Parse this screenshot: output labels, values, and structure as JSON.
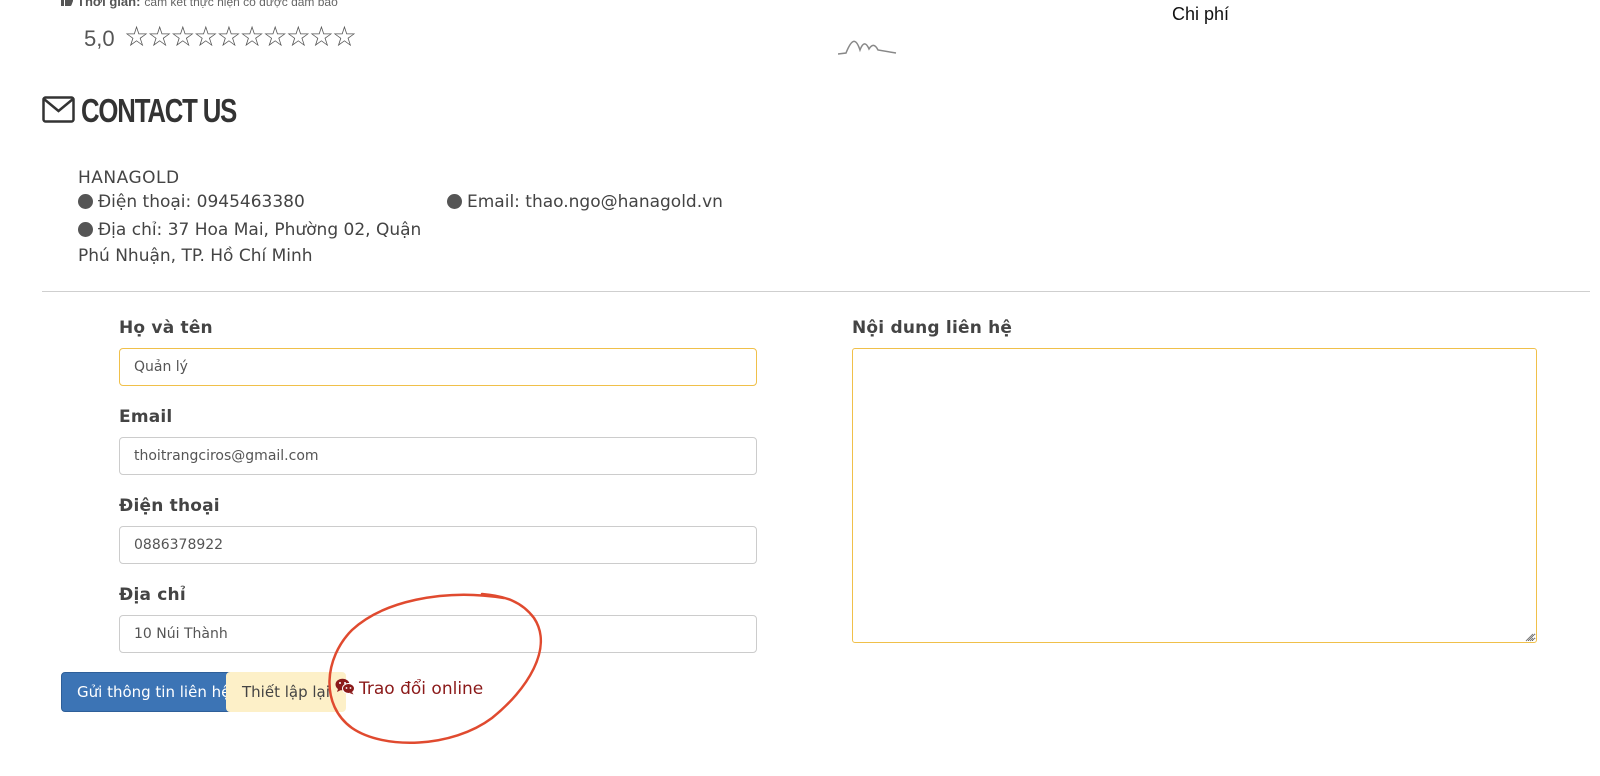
{
  "top": {
    "cut_label": "Thời gian:",
    "cut_value": "cam kết thực hiện có được đảm bảo",
    "rating": "5,0",
    "stars": "☆☆☆☆☆☆☆☆☆☆",
    "right_label": "Chi phí"
  },
  "contact": {
    "heading": "CONTACT US",
    "company": "HANAGOLD",
    "phone": "Điện thoại: 0945463380",
    "email": "Email: thao.ngo@hanagold.vn",
    "address": "Địa chỉ: 37 Hoa Mai, Phường 02, Quận Phú Nhuận, TP. Hồ Chí Minh"
  },
  "form": {
    "name_label": "Họ và tên",
    "name_value": "Quản lý",
    "email_label": "Email",
    "email_value": "thoitrangciros@gmail.com",
    "phone_label": "Điện thoại",
    "phone_value": "0886378922",
    "address_label": "Địa chỉ",
    "address_value": "10 Núi Thành",
    "message_label": "Nội dung liên hệ",
    "message_value": "",
    "submit_label": "Gửi thông tin liên hệ",
    "reset_label": "Thiết lập lại",
    "chat_label": "Trao đổi online"
  },
  "colors": {
    "primary_button": "#3c74b5",
    "reset_button": "#fdf0c8",
    "focus_border": "#f0c04a",
    "chat_link": "#8b1a1a",
    "annotation_circle": "#e04a2f"
  },
  "icons": [
    "thumbs-up-icon",
    "envelope-icon",
    "wechat-icon",
    "resize-grip-icon"
  ]
}
